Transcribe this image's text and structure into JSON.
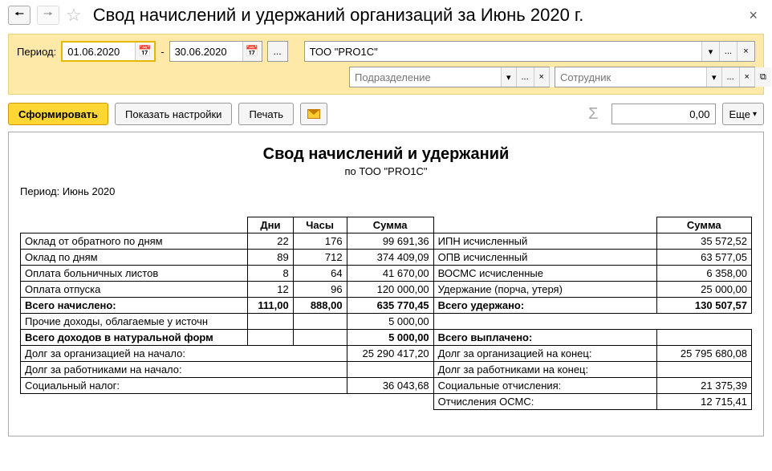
{
  "titlebar": {
    "title": "Свод начислений и удержаний организаций  за Июнь 2020 г."
  },
  "filters": {
    "period_label": "Период:",
    "date_from": "01.06.2020",
    "date_to": "30.06.2020",
    "dash": "-",
    "ellipsis": "...",
    "org_value": "ТОО \"PRO1C\"",
    "dept_placeholder": "Подразделение",
    "emp_placeholder": "Сотрудник"
  },
  "toolbar": {
    "generate": "Сформировать",
    "show_settings": "Показать настройки",
    "print": "Печать",
    "sum_value": "0,00",
    "more": "Еще"
  },
  "report": {
    "title": "Свод начислений и удержаний",
    "subtitle": "по ТОО \"PRO1C\"",
    "period_text": "Период: Июнь 2020",
    "headers": {
      "dni": "Дни",
      "chasy": "Часы",
      "summa": "Сумма"
    },
    "left_rows": [
      {
        "label": "Оклад от обратного по дням",
        "dni": "22",
        "chasy": "176",
        "summa": "99 691,36"
      },
      {
        "label": "Оклад по дням",
        "dni": "89",
        "chasy": "712",
        "summa": "374 409,09"
      },
      {
        "label": "Оплата больничных листов",
        "dni": "8",
        "chasy": "64",
        "summa": "41 670,00"
      },
      {
        "label": "Оплата отпуска",
        "dni": "12",
        "chasy": "96",
        "summa": "120 000,00"
      }
    ],
    "left_total": {
      "label": "Всего начислено:",
      "dni": "111,00",
      "chasy": "888,00",
      "summa": "635 770,45"
    },
    "left_extra": [
      {
        "label": "Прочие доходы, облагаемые у источн",
        "summa": "5 000,00"
      }
    ],
    "left_total2": {
      "label": "Всего доходов в натуральной форм",
      "summa": "5 000,00"
    },
    "left_footer": [
      {
        "label": "Долг за организацией на начало:",
        "summa": "25 290 417,20"
      },
      {
        "label": "Долг за работниками на начало:",
        "summa": ""
      },
      {
        "label": "Социальный налог:",
        "summa": "36 043,68"
      }
    ],
    "right_rows": [
      {
        "label": "ИПН исчисленный",
        "summa": "35 572,52"
      },
      {
        "label": "ОПВ исчисленный",
        "summa": "63 577,05"
      },
      {
        "label": "ВОСМС исчисленные",
        "summa": "6 358,00"
      },
      {
        "label": "Удержание (порча, утеря)",
        "summa": "25 000,00"
      }
    ],
    "right_total": {
      "label": "Всего удержано:",
      "summa": "130 507,57"
    },
    "right_total2": {
      "label": "Всего выплачено:",
      "summa": ""
    },
    "right_footer": [
      {
        "label": "Долг за организацией на конец:",
        "summa": "25 795 680,08"
      },
      {
        "label": "Долг за работниками на конец:",
        "summa": ""
      },
      {
        "label": "Социальные отчисления:",
        "summa": "21 375,39"
      },
      {
        "label": "Отчисления ОСМС:",
        "summa": "12 715,41"
      }
    ]
  }
}
